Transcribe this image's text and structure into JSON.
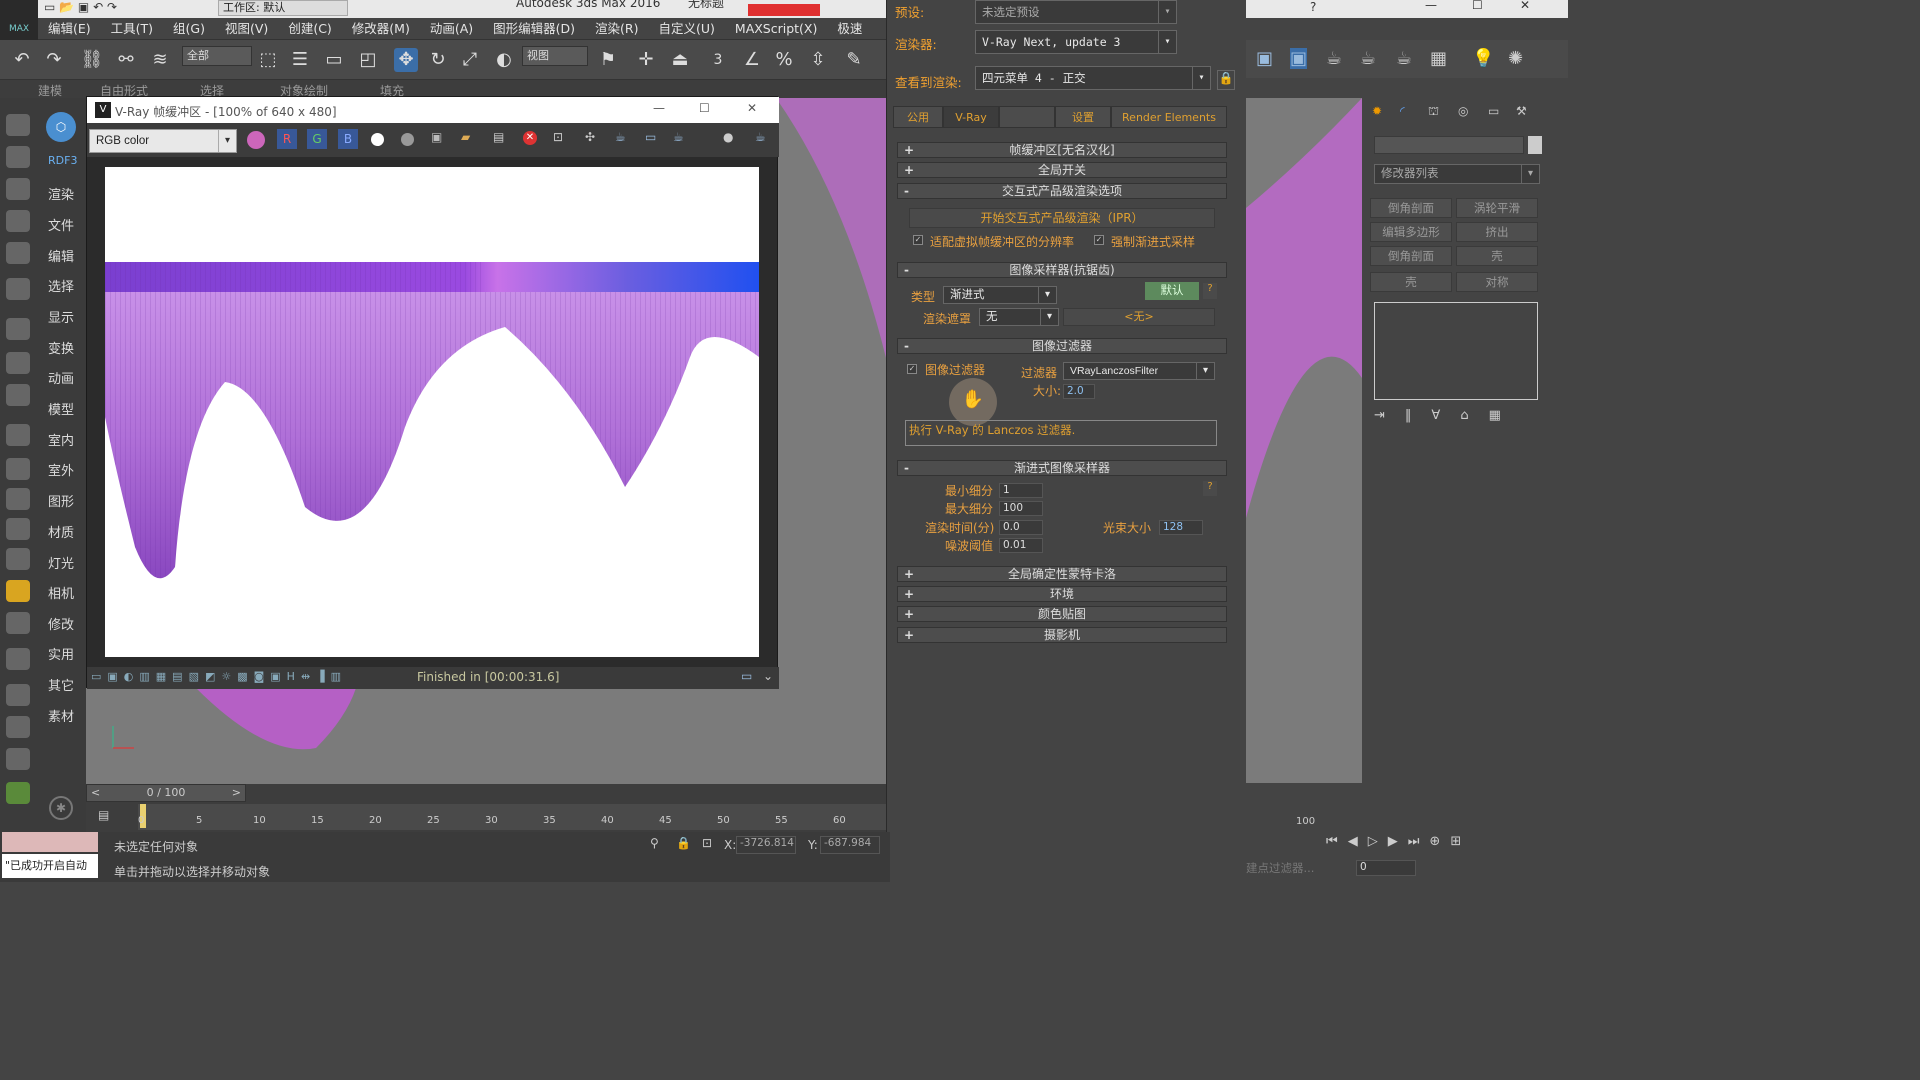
{
  "app": {
    "title": "Autodesk 3ds Max 2016",
    "doc_title": "无标题",
    "workspace": "工作区: 默认",
    "logo": "MAX"
  },
  "menu": [
    "编辑(E)",
    "工具(T)",
    "组(G)",
    "视图(V)",
    "创建(C)",
    "修改器(M)",
    "动画(A)",
    "图形编辑器(D)",
    "渲染(R)",
    "自定义(U)",
    "MAXScript(X)",
    "极速"
  ],
  "toolbar": {
    "select_filter": "全部",
    "view_dropdown": "视图",
    "snap_label": "3"
  },
  "ribbon": [
    "建模",
    "自由形式",
    "选择",
    "对象绘制",
    "填充"
  ],
  "left_categories": [
    "RDF3",
    "渲染",
    "文件",
    "编辑",
    "选择",
    "显示",
    "变换",
    "动画",
    "模型",
    "室内",
    "室外",
    "图形",
    "材质",
    "灯光",
    "相机",
    "修改",
    "实用",
    "其它",
    "素材"
  ],
  "vfb": {
    "title": "V-Ray 帧缓冲区 - [100% of 640 x 480]",
    "channel": "RGB color",
    "status": "Finished in [00:00:31.6]"
  },
  "render_setup": {
    "preset_label": "预设:",
    "preset_value": "未选定预设",
    "renderer_label": "渲染器:",
    "renderer_value": "V-Ray Next, update 3",
    "view_label": "查看到渲染:",
    "view_value": "四元菜单 4 - 正交",
    "tabs": [
      "公用",
      "V-Ray",
      "",
      "设置",
      "Render Elements"
    ],
    "rollouts": {
      "frame_buffer": "帧缓冲区[无名汉化]",
      "global_switches": "全局开关",
      "ipr_options": "交互式产品级渲染选项",
      "ipr_button": "开始交互式产品级渲染（IPR）",
      "fit_vfb": "适配虚拟帧缓冲区的分辨率",
      "force_progressive": "强制渐进式采样",
      "image_sampler": "图像采样器(抗锯齿)",
      "type_label": "类型",
      "type_value": "渐进式",
      "default_button": "默认",
      "help": "?",
      "mask_label": "渲染遮罩",
      "mask_value": "无",
      "mask_none": "<无>",
      "image_filter": "图像过滤器",
      "image_filter_chk": "图像过滤器",
      "filter_label": "过滤器",
      "filter_value": "VRayLanczosFilter",
      "size_label": "大小:",
      "size_value": "2.0",
      "filter_desc": "执行 V-Ray 的 Lanczos 过滤器.",
      "progressive": "渐进式图像采样器",
      "min_subdiv_label": "最小细分",
      "min_subdiv": "1",
      "max_subdiv_label": "最大细分",
      "max_subdiv": "100",
      "render_time_label": "渲染时间(分)",
      "render_time": "0.0",
      "bundle_label": "光束大小",
      "bundle": "128",
      "noise_label": "噪波阈值",
      "noise": "0.01",
      "gi": "全局确定性蒙特卡洛",
      "env": "环境",
      "color_map": "颜色贴图",
      "camera": "摄影机"
    }
  },
  "command_panel": {
    "modifier_list": "修改器列表",
    "buttons": [
      "倒角剖面",
      "涡轮平滑",
      "编辑多边形",
      "挤出",
      "倒角剖面",
      "壳",
      "壳",
      "对称"
    ]
  },
  "timeline": {
    "frame": "0 / 100",
    "ticks": [
      "0",
      "5",
      "10",
      "15",
      "20",
      "25",
      "30",
      "35",
      "40",
      "45",
      "50",
      "55",
      "60"
    ],
    "right_tick": "100"
  },
  "status": {
    "msg1": "未选定任何对象",
    "msg2": "单击并拖动以选择并移动对象",
    "prompt": "\"已成功开启自动",
    "x_label": "X:",
    "x_value": "-3726.814",
    "y_label": "Y:",
    "y_value": "-687.984",
    "frame_spin": "0",
    "filter_text": "建点过滤器..."
  }
}
